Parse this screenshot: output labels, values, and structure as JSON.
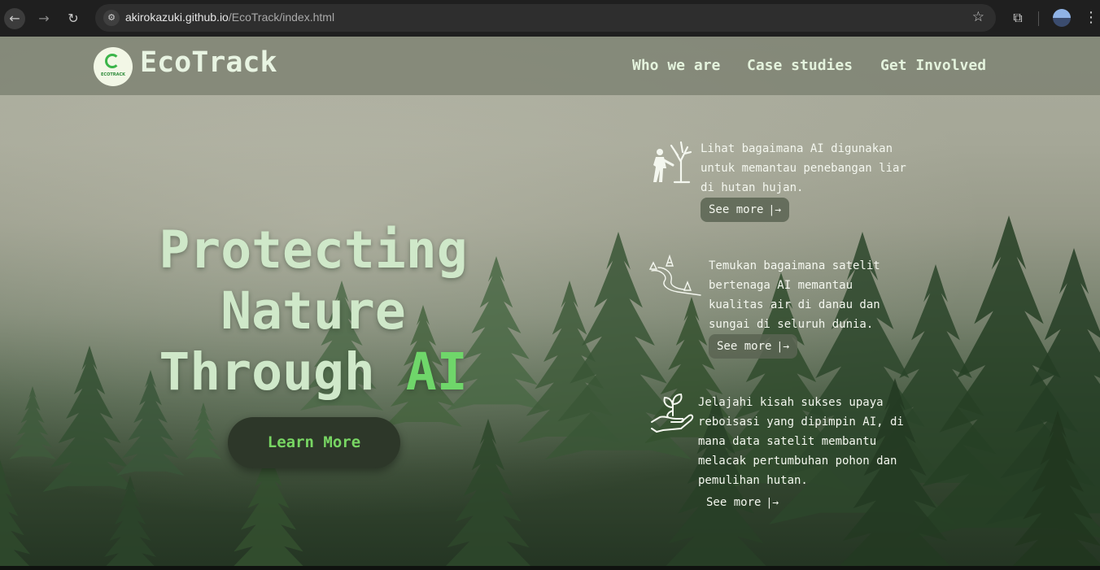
{
  "browser": {
    "url_host": "akirokazuki.github.io",
    "url_path": "/EcoTrack/index.html",
    "back_icon": "arrow-left-icon",
    "forward_icon": "arrow-right-icon",
    "reload_icon": "reload-icon",
    "bookmark_icon": "star-icon",
    "extensions_icon": "puzzle-icon",
    "menu_icon": "more-vertical-icon"
  },
  "header": {
    "logo_text": "ECOTRACK",
    "brand": "EcoTrack",
    "nav": [
      "Who we are",
      "Case studies",
      "Get Involved"
    ]
  },
  "hero": {
    "line1": "Protecting",
    "line2": "Nature",
    "line3_prefix": "Through",
    "line3_highlight": "AI",
    "cta": "Learn More"
  },
  "cards": [
    {
      "icon": "tree-cutting-icon",
      "text": "Lihat bagaimana AI digunakan untuk memantau penebangan liar di hutan hujan.",
      "link": "See more"
    },
    {
      "icon": "river-icon",
      "text": "Temukan bagaimana satelit bertenaga AI memantau kualitas air di danau dan sungai di seluruh dunia.",
      "link": "See more"
    },
    {
      "icon": "plant-in-hand-icon",
      "text": "Jelajahi kisah sukses upaya reboisasi yang dipimpin AI, di mana data satelit membantu melacak pertumbuhan pohon dan pemulihan hutan.",
      "link": "See more"
    }
  ],
  "colors": {
    "accent_green": "#6fd66a",
    "title_mint": "#cfe8c9",
    "cta_bg": "#2d3729"
  }
}
